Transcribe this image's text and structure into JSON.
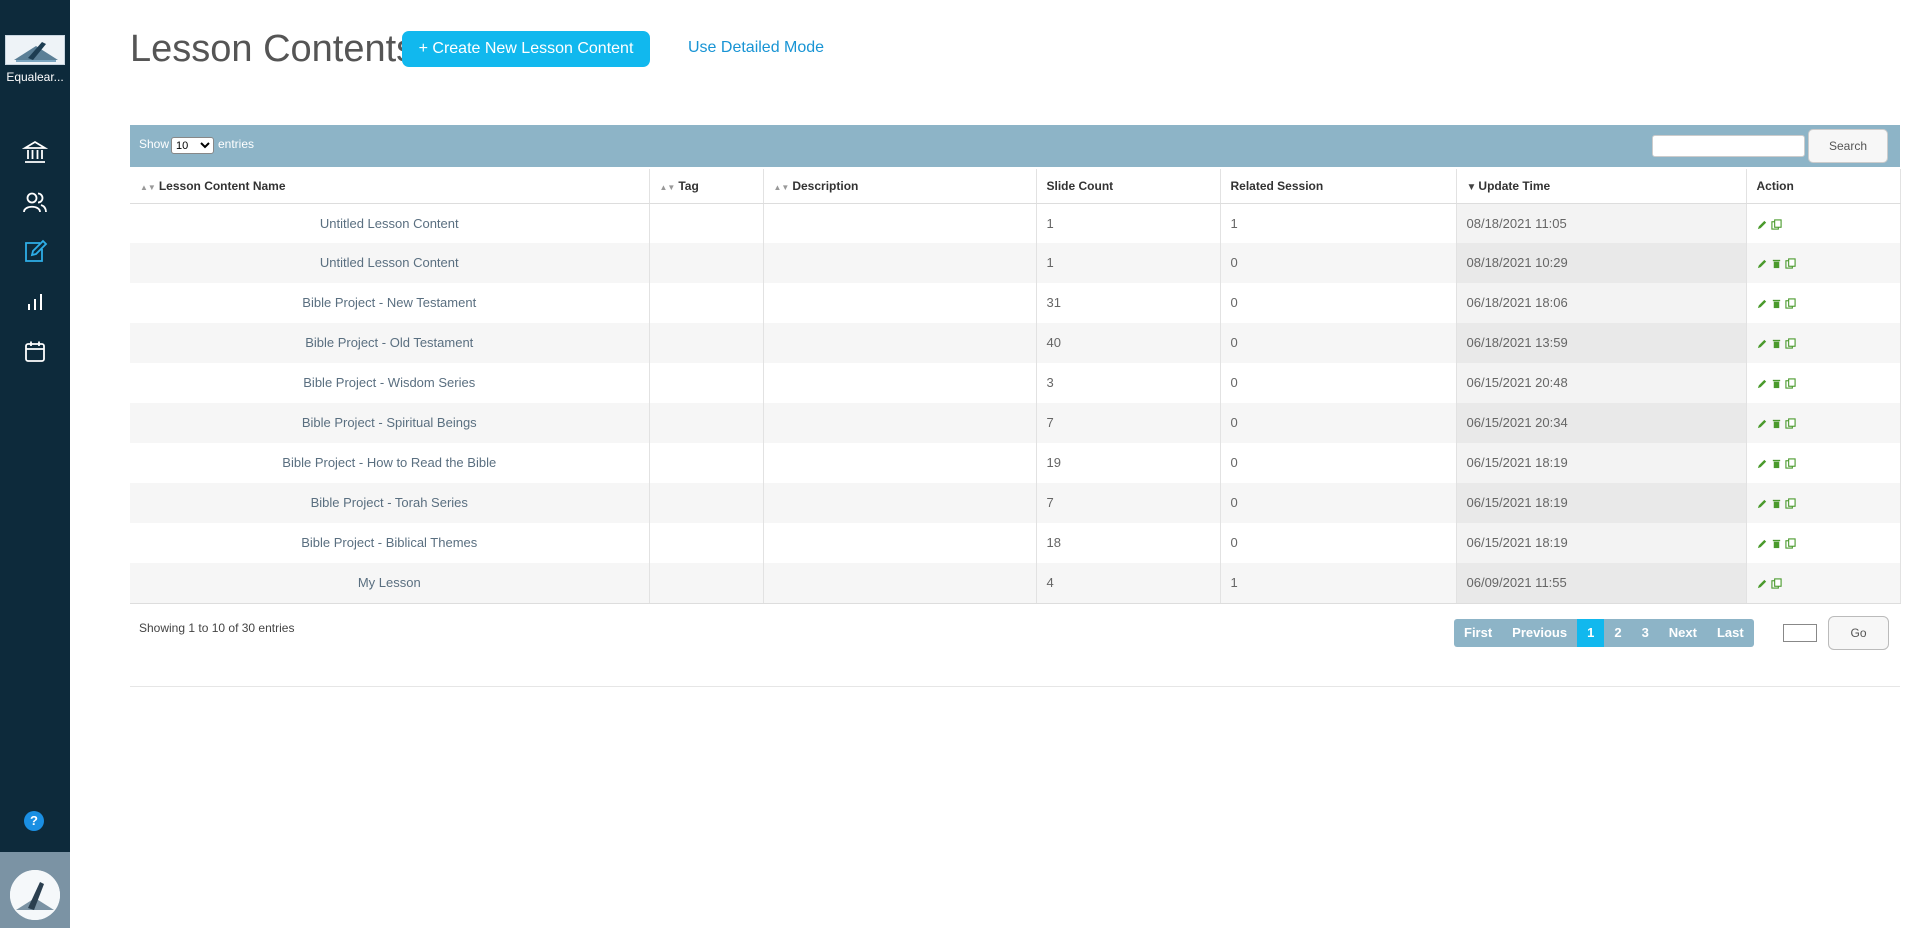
{
  "sidebar": {
    "logo_name": "Equalear...",
    "nav": [
      {
        "icon": "bank-icon"
      },
      {
        "icon": "users-icon"
      },
      {
        "icon": "edit-icon"
      },
      {
        "icon": "chart-icon"
      },
      {
        "icon": "calendar-icon"
      }
    ],
    "help_label": "?"
  },
  "header": {
    "title": "Lesson Contents",
    "create_label": "+ Create New Lesson Content",
    "detail_mode_label": "Use Detailed Mode"
  },
  "toolbar": {
    "show_label": "Show",
    "entries_value": "10",
    "entries_label": "entries",
    "search_label": "Search"
  },
  "table": {
    "columns": [
      "Lesson Content Name",
      "Tag",
      "Description",
      "Slide Count",
      "Related Session",
      "Update Time",
      "Action"
    ],
    "rows": [
      {
        "name": "Untitled Lesson Content",
        "tag": "",
        "description": "",
        "slides": "1",
        "related": "1",
        "updated": "08/18/2021 11:05",
        "actions": [
          "edit",
          "copy"
        ]
      },
      {
        "name": "Untitled Lesson Content",
        "tag": "",
        "description": "",
        "slides": "1",
        "related": "0",
        "updated": "08/18/2021 10:29",
        "actions": [
          "edit",
          "delete",
          "copy"
        ]
      },
      {
        "name": "Bible Project - New Testament",
        "tag": "",
        "description": "",
        "slides": "31",
        "related": "0",
        "updated": "06/18/2021 18:06",
        "actions": [
          "edit",
          "delete",
          "copy"
        ]
      },
      {
        "name": "Bible Project - Old Testament",
        "tag": "",
        "description": "",
        "slides": "40",
        "related": "0",
        "updated": "06/18/2021 13:59",
        "actions": [
          "edit",
          "delete",
          "copy"
        ]
      },
      {
        "name": "Bible Project - Wisdom Series",
        "tag": "",
        "description": "",
        "slides": "3",
        "related": "0",
        "updated": "06/15/2021 20:48",
        "actions": [
          "edit",
          "delete",
          "copy"
        ]
      },
      {
        "name": "Bible Project - Spiritual Beings",
        "tag": "",
        "description": "",
        "slides": "7",
        "related": "0",
        "updated": "06/15/2021 20:34",
        "actions": [
          "edit",
          "delete",
          "copy"
        ]
      },
      {
        "name": "Bible Project - How to Read the Bible",
        "tag": "",
        "description": "",
        "slides": "19",
        "related": "0",
        "updated": "06/15/2021 18:19",
        "actions": [
          "edit",
          "delete",
          "copy"
        ]
      },
      {
        "name": "Bible Project - Torah Series",
        "tag": "",
        "description": "",
        "slides": "7",
        "related": "0",
        "updated": "06/15/2021 18:19",
        "actions": [
          "edit",
          "delete",
          "copy"
        ]
      },
      {
        "name": "Bible Project - Biblical Themes",
        "tag": "",
        "description": "",
        "slides": "18",
        "related": "0",
        "updated": "06/15/2021 18:19",
        "actions": [
          "edit",
          "delete",
          "copy"
        ]
      },
      {
        "name": "My Lesson",
        "tag": "",
        "description": "",
        "slides": "4",
        "related": "1",
        "updated": "06/09/2021 11:55",
        "actions": [
          "edit",
          "copy"
        ]
      }
    ]
  },
  "footer": {
    "showing_text": "Showing 1 to 10 of 30 entries",
    "pager": [
      "First",
      "Previous",
      "1",
      "2",
      "3",
      "Next",
      "Last"
    ],
    "active_page": "1",
    "go_label": "Go"
  },
  "colors": {
    "sidebar_bg": "#0d2a3b",
    "accent": "#11b8ee",
    "toolbar_bg": "#8db4c7",
    "action_green": "#4a9a2c"
  }
}
